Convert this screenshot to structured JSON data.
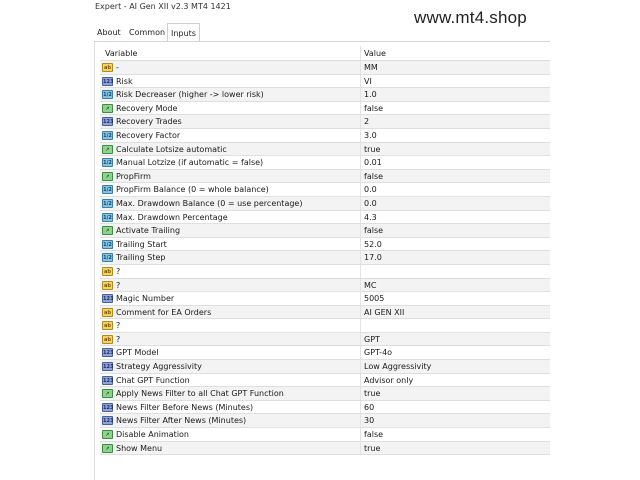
{
  "window": {
    "title": "Expert - AI Gen XII v2.3 MT4 1421"
  },
  "watermark": "www.mt4.shop",
  "tabs": [
    {
      "label": "About"
    },
    {
      "label": "Common"
    },
    {
      "label": "Inputs"
    }
  ],
  "table": {
    "headers": {
      "variable": "Variable",
      "value": "Value"
    },
    "rows": [
      {
        "name": "-",
        "value": "MM",
        "type": "ab"
      },
      {
        "name": "Risk",
        "value": "VI",
        "type": "num"
      },
      {
        "name": "Risk Decreaser (higher -> lower risk)",
        "value": "1.0",
        "type": "dbl"
      },
      {
        "name": "Recovery Mode",
        "value": "false",
        "type": "bool"
      },
      {
        "name": "Recovery Trades",
        "value": "2",
        "type": "num"
      },
      {
        "name": "Recovery Factor",
        "value": "3.0",
        "type": "dbl"
      },
      {
        "name": "Calculate Lotsize automatic",
        "value": "true",
        "type": "bool"
      },
      {
        "name": "Manual Lotzize (if automatic = false)",
        "value": "0.01",
        "type": "dbl"
      },
      {
        "name": "PropFirm",
        "value": "false",
        "type": "bool"
      },
      {
        "name": "PropFirm Balance (0 = whole balance)",
        "value": "0.0",
        "type": "dbl"
      },
      {
        "name": "Max. Drawdown Balance (0 = use percentage)",
        "value": "0.0",
        "type": "dbl"
      },
      {
        "name": "Max. Drawdown Percentage",
        "value": "4.3",
        "type": "dbl"
      },
      {
        "name": "Activate Trailing",
        "value": "false",
        "type": "bool"
      },
      {
        "name": "Trailing Start",
        "value": "52.0",
        "type": "dbl"
      },
      {
        "name": "Trailing Step",
        "value": "17.0",
        "type": "dbl"
      },
      {
        "name": "?",
        "value": "",
        "type": "ab"
      },
      {
        "name": "?",
        "value": "MC",
        "type": "ab"
      },
      {
        "name": "Magic Number",
        "value": "5005",
        "type": "num"
      },
      {
        "name": "Comment for EA Orders",
        "value": "AI GEN XII",
        "type": "ab"
      },
      {
        "name": "?",
        "value": "",
        "type": "ab"
      },
      {
        "name": "?",
        "value": "GPT",
        "type": "ab"
      },
      {
        "name": "GPT Model",
        "value": "GPT-4o",
        "type": "num"
      },
      {
        "name": "Strategy Aggressivity",
        "value": "Low Aggressivity",
        "type": "num"
      },
      {
        "name": "Chat GPT Function",
        "value": "Advisor only",
        "type": "num"
      },
      {
        "name": "Apply News Filter to all Chat GPT Function",
        "value": "true",
        "type": "bool"
      },
      {
        "name": "News Filter Before News (Minutes)",
        "value": "60",
        "type": "num"
      },
      {
        "name": "News Filter After News (Minutes)",
        "value": "30",
        "type": "num"
      },
      {
        "name": "Disable Animation",
        "value": "false",
        "type": "bool"
      },
      {
        "name": "Show Menu",
        "value": "true",
        "type": "bool"
      }
    ]
  },
  "icons": {
    "ab": "string-type-icon",
    "num": "integer-type-icon",
    "dbl": "double-type-icon",
    "bool": "boolean-type-icon"
  }
}
